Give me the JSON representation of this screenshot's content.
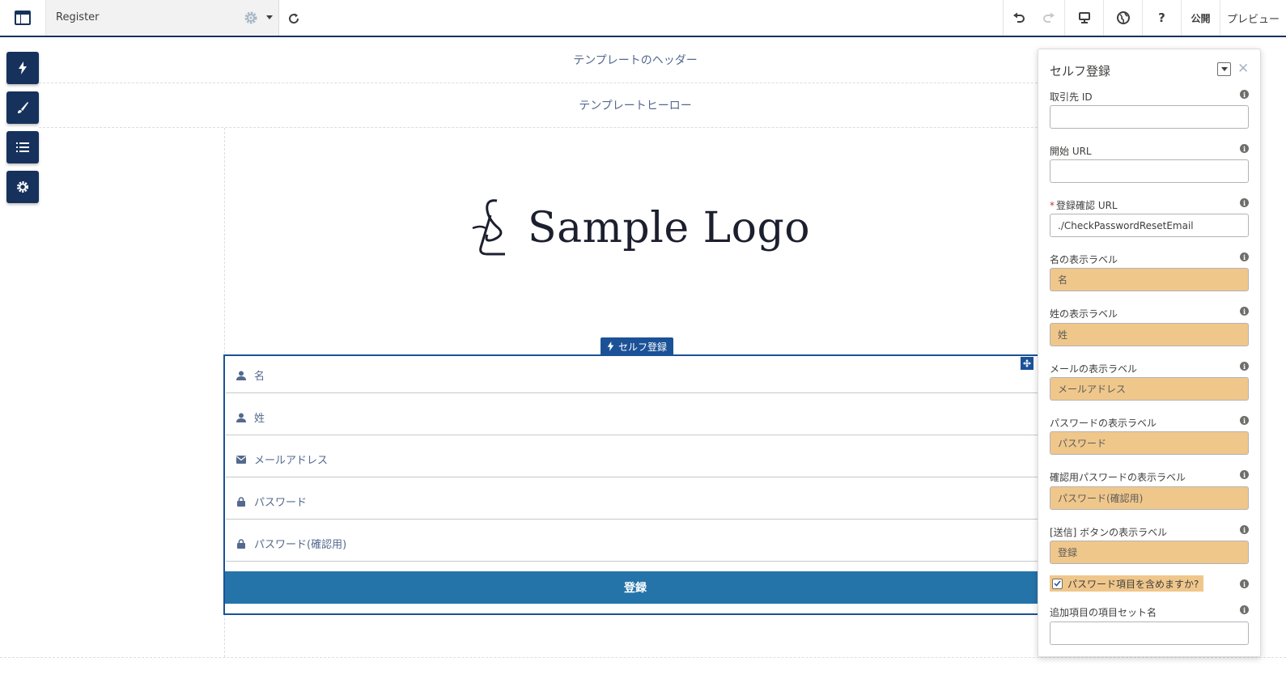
{
  "topbar": {
    "page_name": "Register",
    "publish_label": "公開",
    "preview_label": "プレビュー",
    "help_label": "?"
  },
  "canvas": {
    "header_region": "テンプレートのヘッダー",
    "hero_region": "テンプレートヒーロー",
    "logo_text": "Sample Logo",
    "component_tag": "セルフ登録",
    "fields": [
      {
        "icon": "user-icon",
        "label": "名"
      },
      {
        "icon": "user-icon",
        "label": "姓"
      },
      {
        "icon": "email-icon",
        "label": "メールアドレス"
      },
      {
        "icon": "lock-icon",
        "label": "パスワード"
      },
      {
        "icon": "lock-icon",
        "label": "パスワード(確認用)"
      }
    ],
    "submit_label": "登録"
  },
  "panel": {
    "title": "セルフ登録",
    "properties": [
      {
        "label": "取引先 ID",
        "value": "",
        "required": false,
        "highlight": false
      },
      {
        "label": "開始 URL",
        "value": "",
        "required": false,
        "highlight": false
      },
      {
        "label": "登録確認 URL",
        "value": "./CheckPasswordResetEmail",
        "required": true,
        "highlight": false
      },
      {
        "label": "名の表示ラベル",
        "value": "名",
        "required": false,
        "highlight": true
      },
      {
        "label": "姓の表示ラベル",
        "value": "姓",
        "required": false,
        "highlight": true
      },
      {
        "label": "メールの表示ラベル",
        "value": "メールアドレス",
        "required": false,
        "highlight": true
      },
      {
        "label": "パスワードの表示ラベル",
        "value": "パスワード",
        "required": false,
        "highlight": true
      },
      {
        "label": "確認用パスワードの表示ラベル",
        "value": "パスワード(確認用)",
        "required": false,
        "highlight": true
      },
      {
        "label": "[送信] ボタンの表示ラベル",
        "value": "登録",
        "required": false,
        "highlight": true
      }
    ],
    "checkbox_label": "パスワード項目を含めますか?",
    "checkbox_checked": true,
    "extra_label": "追加項目の項目セット名",
    "extra_value": "",
    "required_mark": "*",
    "info_glyph": "i"
  },
  "colors": {
    "brand_navy": "#16325c",
    "component_blue": "#1b5297",
    "submit_blue": "#2574a9",
    "highlight": "#f0c78b"
  }
}
